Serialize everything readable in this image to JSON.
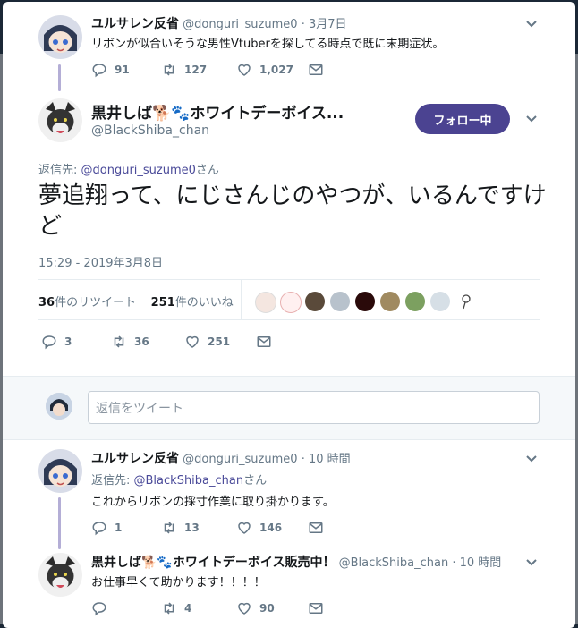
{
  "tweets": {
    "t1": {
      "name": "ユルサレン反省",
      "handle": "@donguri_suzume0",
      "sep": "·",
      "time": "3月7日",
      "text": "リボンが似合いそうな男性Vtuberを探してる時点で既に末期症状。",
      "replies": "91",
      "retweets": "127",
      "likes": "1,027"
    },
    "main": {
      "name": "黒井しば🐕🐾ホワイトデーボイス...",
      "handle": "@BlackShiba_chan",
      "follow_label": "フォロー中",
      "reply_prefix": "返信先: ",
      "reply_handle": "@donguri_suzume0",
      "reply_suffix": "さん",
      "text": "夢追翔って、にじさんじのやつが、いるんですけど",
      "timestamp": "15:29 - 2019年3月8日",
      "rt_count": "36",
      "rt_label": "件のリツイート",
      "like_count": "251",
      "like_label": "件のいいね",
      "replies": "3",
      "retweets": "36",
      "likes": "251"
    },
    "reply_placeholder": "返信をツイート",
    "t3": {
      "name": "ユルサレン反省",
      "handle": "@donguri_suzume0",
      "sep": "·",
      "time": "10 時間",
      "reply_prefix": "返信先: ",
      "reply_handle": "@BlackShiba_chan",
      "reply_suffix": "さん",
      "text": "これからリボンの採寸作業に取り掛かります。",
      "replies": "1",
      "retweets": "13",
      "likes": "146"
    },
    "t4": {
      "name": "黒井しば🐕🐾ホワイトデーボイス販売中！",
      "handle": "@BlackShiba_chan",
      "sep": "·",
      "time": "10 時間",
      "text": "お仕事早くて助かります！！！！",
      "replies": "",
      "retweets": "4",
      "likes": "90"
    }
  },
  "colors": {
    "accent": "#4b4391",
    "link": "#4a4a99",
    "muted": "#657786",
    "thread": "#b4aed6"
  }
}
